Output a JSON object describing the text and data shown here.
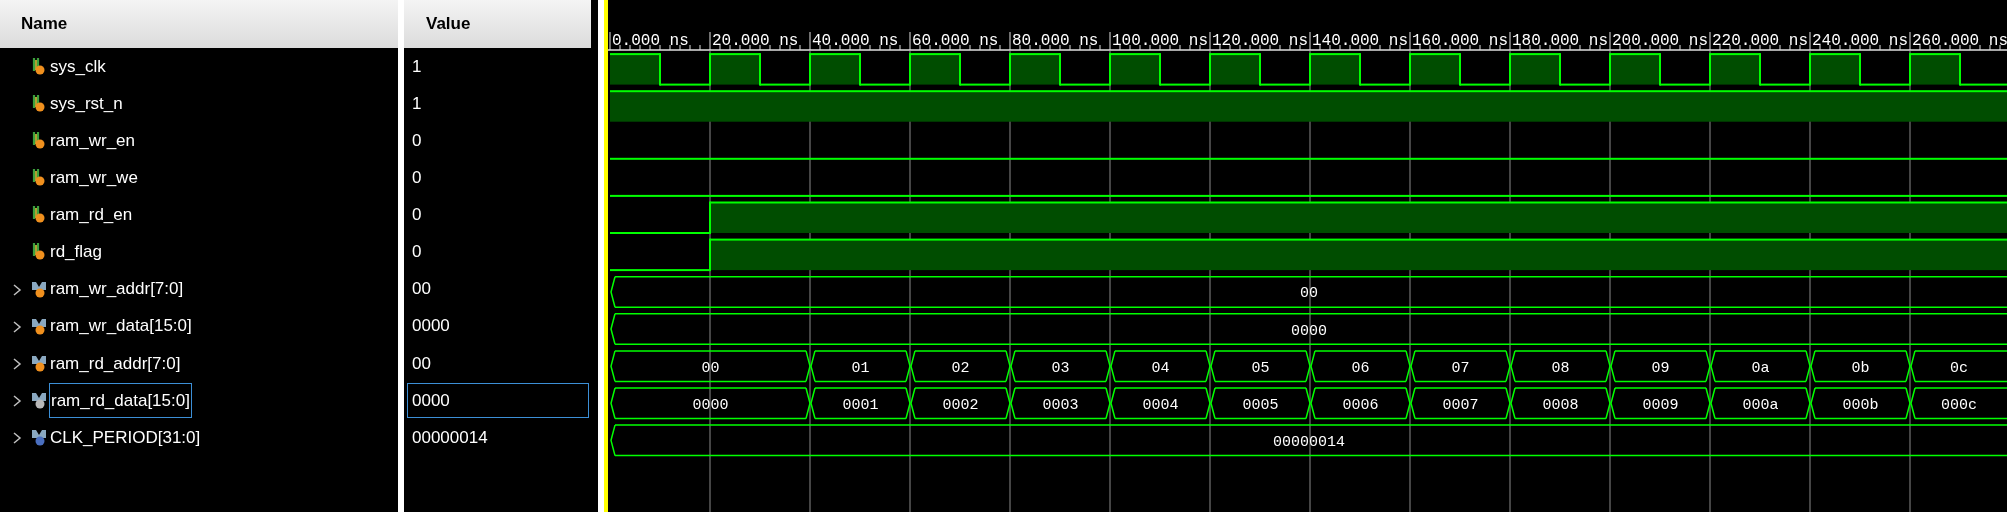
{
  "columns": {
    "name": "Name",
    "value": "Value"
  },
  "ruler": {
    "labels": [
      "0.000 ns",
      "20.000 ns",
      "40.000 ns",
      "60.000 ns",
      "80.000 ns",
      "100.000 ns",
      "120.000 ns",
      "140.000 ns",
      "160.000 ns",
      "180.000 ns",
      "200.000 ns",
      "220.000 ns",
      "240.000 ns",
      "260.000 ns"
    ]
  },
  "signals": [
    {
      "name": "sys_clk",
      "value": "1",
      "kind": "wire",
      "selected": false,
      "high": [
        true,
        false,
        true,
        false,
        true,
        false,
        true,
        false,
        true,
        false,
        true,
        false,
        true,
        false,
        true,
        false,
        true,
        false,
        true,
        false,
        true,
        false,
        true,
        false,
        true,
        false,
        true,
        false
      ]
    },
    {
      "name": "sys_rst_n",
      "value": "1",
      "kind": "wire",
      "selected": false,
      "high": [
        true,
        true,
        true,
        true,
        true,
        true,
        true,
        true,
        true,
        true,
        true,
        true,
        true,
        true,
        true,
        true,
        true,
        true,
        true,
        true,
        true,
        true,
        true,
        true,
        true,
        true,
        true,
        true
      ]
    },
    {
      "name": "ram_wr_en",
      "value": "0",
      "kind": "wire",
      "selected": false,
      "high": [
        false,
        false,
        false,
        false,
        false,
        false,
        false,
        false,
        false,
        false,
        false,
        false,
        false,
        false,
        false,
        false,
        false,
        false,
        false,
        false,
        false,
        false,
        false,
        false,
        false,
        false,
        false,
        false
      ]
    },
    {
      "name": "ram_wr_we",
      "value": "0",
      "kind": "wire",
      "selected": false,
      "high": [
        false,
        false,
        false,
        false,
        false,
        false,
        false,
        false,
        false,
        false,
        false,
        false,
        false,
        false,
        false,
        false,
        false,
        false,
        false,
        false,
        false,
        false,
        false,
        false,
        false,
        false,
        false,
        false
      ]
    },
    {
      "name": "ram_rd_en",
      "value": "0",
      "kind": "wire",
      "selected": false,
      "high": [
        false,
        false,
        true,
        true,
        true,
        true,
        true,
        true,
        true,
        true,
        true,
        true,
        true,
        true,
        true,
        true,
        true,
        true,
        true,
        true,
        true,
        true,
        true,
        true,
        true,
        true,
        true,
        true
      ]
    },
    {
      "name": "rd_flag",
      "value": "0",
      "kind": "wire",
      "selected": false,
      "high": [
        false,
        false,
        true,
        true,
        true,
        true,
        true,
        true,
        true,
        true,
        true,
        true,
        true,
        true,
        true,
        true,
        true,
        true,
        true,
        true,
        true,
        true,
        true,
        true,
        true,
        true,
        true,
        true
      ]
    },
    {
      "name": "ram_wr_addr[7:0]",
      "value": "00",
      "kind": "bus",
      "selected": false,
      "expanded": false,
      "transitions": [
        true,
        false,
        false,
        false,
        false,
        false,
        false,
        false,
        false,
        false,
        false,
        false,
        false,
        false
      ],
      "segments": [
        "00"
      ]
    },
    {
      "name": "ram_wr_data[15:0]",
      "value": "0000",
      "kind": "bus",
      "selected": false,
      "expanded": false,
      "transitions": [
        true,
        false,
        false,
        false,
        false,
        false,
        false,
        false,
        false,
        false,
        false,
        false,
        false,
        false
      ],
      "segments": [
        "0000"
      ]
    },
    {
      "name": "ram_rd_addr[7:0]",
      "value": "00",
      "kind": "bus",
      "selected": false,
      "expanded": false,
      "transitions": [
        true,
        false,
        true,
        true,
        true,
        true,
        true,
        true,
        true,
        true,
        true,
        true,
        true,
        true
      ],
      "segments": [
        "00",
        "01",
        "02",
        "03",
        "04",
        "05",
        "06",
        "07",
        "08",
        "09",
        "0a",
        "0b",
        "0c"
      ]
    },
    {
      "name": "ram_rd_data[15:0]",
      "value": "0000",
      "kind": "bus_out",
      "selected": true,
      "expanded": false,
      "transitions": [
        true,
        false,
        true,
        true,
        true,
        true,
        true,
        true,
        true,
        true,
        true,
        true,
        true,
        true
      ],
      "segments": [
        "0000",
        "0001",
        "0002",
        "0003",
        "0004",
        "0005",
        "0006",
        "0007",
        "0008",
        "0009",
        "000a",
        "000b",
        "000c"
      ]
    },
    {
      "name": "CLK_PERIOD[31:0]",
      "value": "00000014",
      "kind": "parameter",
      "selected": false,
      "expanded": false,
      "transitions": [
        true,
        false,
        false,
        false,
        false,
        false,
        false,
        false,
        false,
        false,
        false,
        false,
        false,
        false
      ],
      "segments": [
        "00000014"
      ]
    }
  ]
}
